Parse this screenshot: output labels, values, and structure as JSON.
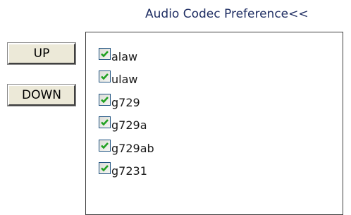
{
  "header": {
    "title": "Audio Codec Preference<<"
  },
  "buttons": {
    "up_label": "UP",
    "down_label": "DOWN"
  },
  "codecs": [
    {
      "label": "alaw",
      "checked": true
    },
    {
      "label": "ulaw",
      "checked": true
    },
    {
      "label": "g729",
      "checked": true
    },
    {
      "label": "g729a",
      "checked": true
    },
    {
      "label": "g729ab",
      "checked": true
    },
    {
      "label": "g7231",
      "checked": true
    }
  ],
  "colors": {
    "check": "#21a121",
    "title": "#1f2e63"
  }
}
